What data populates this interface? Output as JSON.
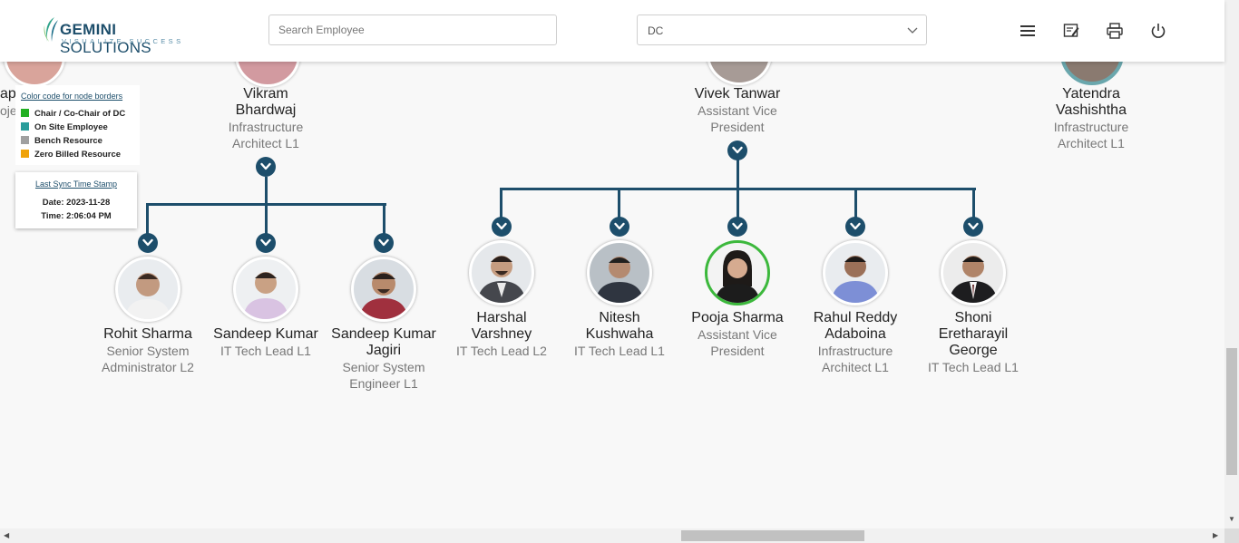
{
  "app": {
    "logo_brand": "GEMINI",
    "logo_word": "SOLUTIONS",
    "logo_tagline": "VISUALIZE SUCCESS"
  },
  "header": {
    "search_placeholder": "Search Employee",
    "search_value": "",
    "department_selected": "DC",
    "icons": [
      "menu-icon",
      "report-icon",
      "print-icon",
      "power-icon"
    ]
  },
  "legend": {
    "title": "Color code for node borders",
    "items": [
      {
        "label": "Chair / Co-Chair of DC",
        "color": "#22b022"
      },
      {
        "label": "On Site Employee",
        "color": "#2a9d9b"
      },
      {
        "label": "Bench Resource",
        "color": "#a0a0a0"
      },
      {
        "label": "Zero Billed Resource",
        "color": "#f0a30a"
      }
    ]
  },
  "sync": {
    "title": "Last Sync Time Stamp",
    "date": "Date: 2023-11-28",
    "time": "Time: 2:06:04 PM"
  },
  "partial_left": {
    "name_fragment": "ap",
    "title_fragment": "ojec"
  },
  "top_nodes": [
    {
      "name_line1": "Vikram",
      "name_line2": "Bhardwaj",
      "title_line1": "Infrastructure",
      "title_line2": "Architect L1"
    },
    {
      "name_line1": "Vivek Tanwar",
      "title_line1": "Assistant Vice",
      "title_line2": "President"
    },
    {
      "name_line1": "Yatendra",
      "name_line2": "Vashishtha",
      "title_line1": "Infrastructure",
      "title_line2": "Architect L1"
    }
  ],
  "vikram_reports": [
    {
      "name_line1": "Rohit Sharma",
      "title_line1": "Senior System",
      "title_line2": "Administrator L2"
    },
    {
      "name_line1": "Sandeep Kumar",
      "title_line1": "IT Tech Lead L1"
    },
    {
      "name_line1": "Sandeep Kumar",
      "name_line2": "Jagiri",
      "title_line1": "Senior System",
      "title_line2": "Engineer L1"
    }
  ],
  "vivek_reports": [
    {
      "name_line1": "Harshal",
      "name_line2": "Varshney",
      "title_line1": "IT Tech Lead L2"
    },
    {
      "name_line1": "Nitesh",
      "name_line2": "Kushwaha",
      "title_line1": "IT Tech Lead L1"
    },
    {
      "name_line1": "Pooja Sharma",
      "title_line1": "Assistant Vice",
      "title_line2": "President",
      "border": "chair"
    },
    {
      "name_line1": "Rahul Reddy",
      "name_line2": "Adaboina",
      "title_line1": "Infrastructure",
      "title_line2": "Architect L1"
    },
    {
      "name_line1": "Shoni",
      "name_line2": "Eretharayil",
      "name_line3": "George",
      "title_line1": "IT Tech Lead L1"
    }
  ],
  "colors": {
    "connector": "#1d4e6b",
    "chair_border": "#3cb83c",
    "onsite_border": "#6aa7ad"
  }
}
